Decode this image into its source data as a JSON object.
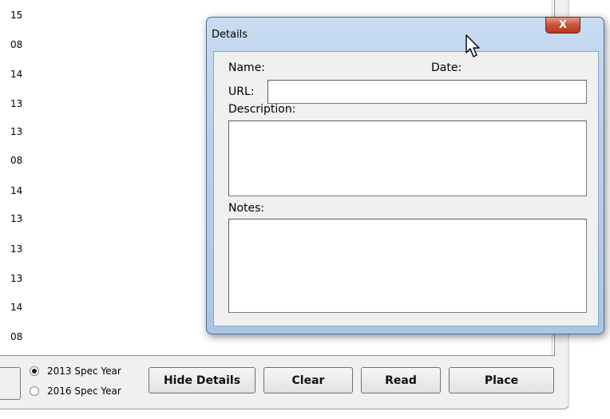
{
  "list": {
    "rows": [
      "15",
      "08",
      "14",
      "13",
      "13",
      "08",
      "14",
      "13",
      "13",
      "13",
      "14",
      "08"
    ]
  },
  "controls": {
    "radio_2013": "2013 Spec Year",
    "radio_2016": "2016 Spec Year",
    "hide_details": "Hide Details",
    "clear": "Clear",
    "read": "Read",
    "place": "Place"
  },
  "dialog": {
    "title": "Details",
    "close_glyph": "X",
    "name_label": "Name:",
    "date_label": "Date:",
    "url_label": "URL:",
    "url_value": "",
    "description_label": "Description:",
    "description_value": "",
    "notes_label": "Notes:",
    "notes_value": ""
  },
  "colors": {
    "accent_titlebar": "#b9d1ec",
    "close_button": "#c7513a"
  },
  "icons": [
    "radio-selected-icon",
    "radio-unselected-icon",
    "mouse-pointer-icon",
    "close-icon"
  ]
}
